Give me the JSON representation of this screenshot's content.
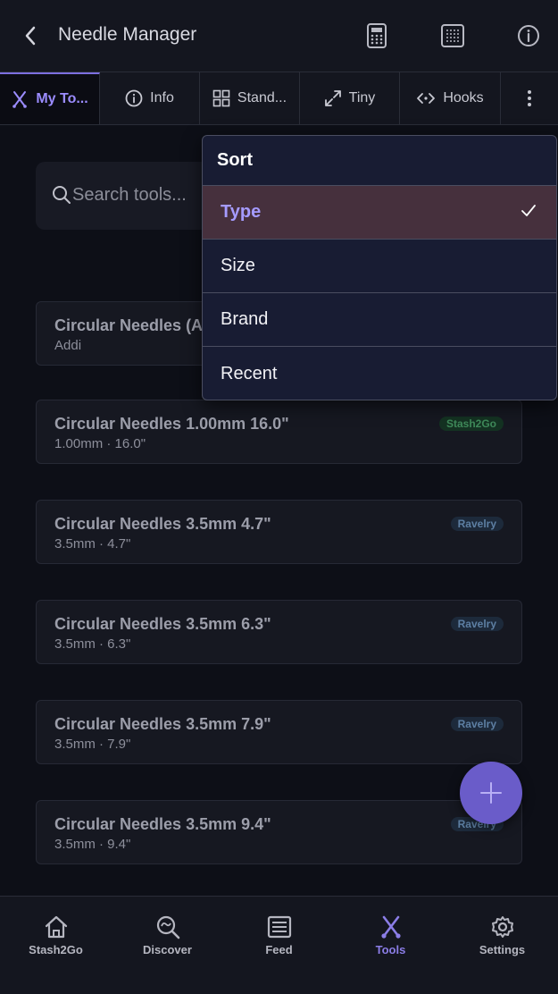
{
  "header": {
    "title": "Needle Manager"
  },
  "tabs": [
    {
      "label": "My To...",
      "icon": "tools-icon",
      "active": true
    },
    {
      "label": "Info",
      "icon": "info-icon"
    },
    {
      "label": "Stand...",
      "icon": "grid-icon"
    },
    {
      "label": "Tiny",
      "icon": "expand-icon"
    },
    {
      "label": "Hooks",
      "icon": "code-icon"
    }
  ],
  "search": {
    "placeholder": "Search tools..."
  },
  "cards": [
    {
      "title": "Circular Needles (Addi)",
      "subtitle": "Addi",
      "badge": ""
    },
    {
      "title": "Circular Needles 1.00mm 16.0\"",
      "subtitle": "1.00mm · 16.0\"",
      "badge": "Stash2Go",
      "badge_color": "#3f8a5a"
    },
    {
      "title": "Circular Needles 3.5mm 4.7\"",
      "subtitle": "3.5mm · 4.7\"",
      "badge": "Ravelry",
      "badge_color": "#5d7fa3"
    },
    {
      "title": "Circular Needles 3.5mm 6.3\"",
      "subtitle": "3.5mm · 6.3\"",
      "badge": "Ravelry",
      "badge_color": "#5d7fa3"
    },
    {
      "title": "Circular Needles 3.5mm 7.9\"",
      "subtitle": "3.5mm · 7.9\"",
      "badge": "Ravelry",
      "badge_color": "#5d7fa3"
    },
    {
      "title": "Circular Needles 3.5mm 9.4\"",
      "subtitle": "3.5mm · 9.4\"",
      "badge": "Ravelry",
      "badge_color": "#5d7fa3"
    }
  ],
  "sort_menu": {
    "title": "Sort",
    "options": [
      "Type",
      "Size",
      "Brand",
      "Recent"
    ],
    "selected": "Type"
  },
  "bottom_nav": [
    {
      "label": "Stash2Go",
      "icon": "home-icon"
    },
    {
      "label": "Discover",
      "icon": "discover-icon"
    },
    {
      "label": "Feed",
      "icon": "feed-icon"
    },
    {
      "label": "Tools",
      "icon": "tools-icon",
      "active": true
    },
    {
      "label": "Settings",
      "icon": "settings-icon"
    }
  ],
  "colors": {
    "accent": "#8b7de6",
    "fab": "#6a5cc9",
    "selected_bg": "#46303d"
  }
}
